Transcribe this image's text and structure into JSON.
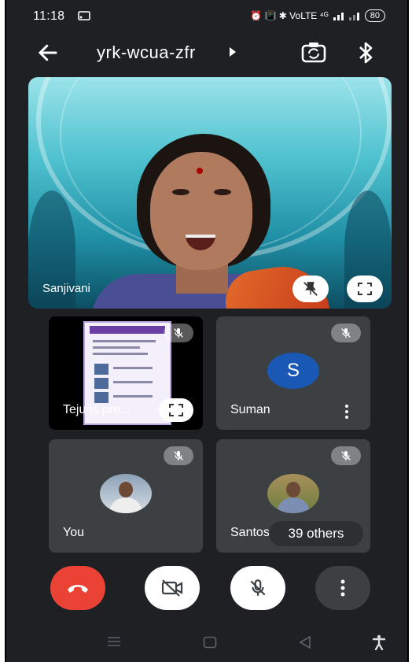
{
  "status_bar": {
    "time": "11:18",
    "icons_text": "⏰ 📳 ✱ VoLTE ⁴ᴳ",
    "battery": "80"
  },
  "top_bar": {
    "meeting_code": "yrk-wcua-zfr"
  },
  "main_tile": {
    "participant_name": "Sanjivani"
  },
  "tiles": {
    "teju": {
      "label": "Teju is pre..."
    },
    "suman": {
      "name": "Suman",
      "avatar_initial": "S",
      "avatar_color": "#1a58b5"
    },
    "you": {
      "name": "You"
    },
    "santosh": {
      "name": "Santos"
    }
  },
  "others_chip": {
    "label": "39 others"
  },
  "colors": {
    "end_call": "#ea4335",
    "background": "#1f2023",
    "tile_bg": "#3c4043"
  },
  "icons": {
    "back": "arrow-left-icon",
    "flip_camera": "flip-camera-icon",
    "bluetooth": "bluetooth-icon",
    "muted_mic": "mic-off-icon",
    "pin": "pin-off-icon",
    "fullscreen": "fullscreen-icon",
    "end_call": "phone-hangup-icon",
    "camera_off": "camera-off-icon",
    "more": "more-vert-icon"
  }
}
